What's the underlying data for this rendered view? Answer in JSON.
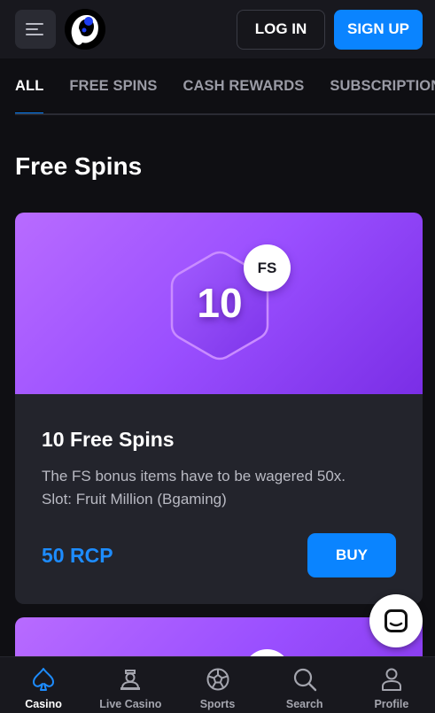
{
  "header": {
    "login_label": "LOG IN",
    "signup_label": "SIGN UP"
  },
  "tabs": [
    {
      "label": "ALL",
      "active": true
    },
    {
      "label": "FREE SPINS",
      "active": false
    },
    {
      "label": "CASH REWARDS",
      "active": false
    },
    {
      "label": "SUBSCRIPTIONS",
      "active": false
    }
  ],
  "section_title": "Free Spins",
  "offers": [
    {
      "badge_number": "10",
      "badge_tag": "FS",
      "title": "10 Free Spins",
      "description_line1": "The FS bonus items have to be wagered 50x.",
      "description_line2": "Slot: Fruit Million (Bgaming)",
      "price": "50 RCP",
      "buy_label": "BUY"
    }
  ],
  "bottom_nav": [
    {
      "label": "Casino",
      "icon": "spade-icon",
      "active": true
    },
    {
      "label": "Live Casino",
      "icon": "dealer-icon",
      "active": false
    },
    {
      "label": "Sports",
      "icon": "soccer-ball-icon",
      "active": false
    },
    {
      "label": "Search",
      "icon": "search-icon",
      "active": false
    },
    {
      "label": "Profile",
      "icon": "user-icon",
      "active": false
    }
  ],
  "colors": {
    "accent": "#0a84ff",
    "price": "#1d8cff",
    "banner_start": "#b86bff",
    "banner_end": "#7a2ee6"
  }
}
